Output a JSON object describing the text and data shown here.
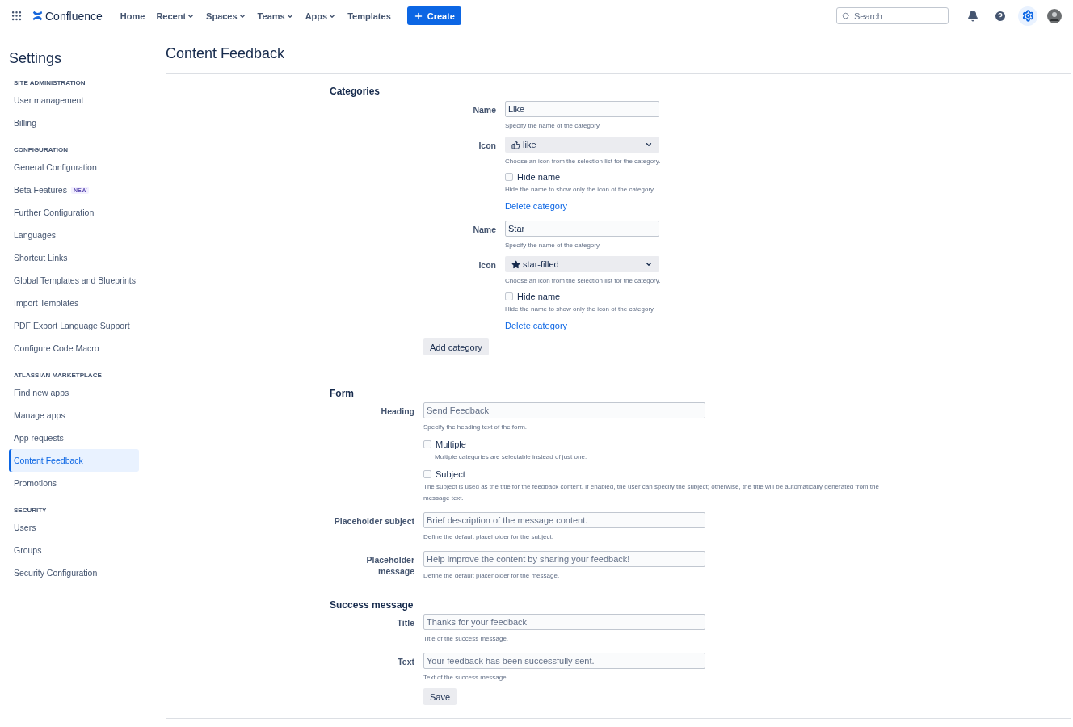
{
  "topbar": {
    "product": "Confluence",
    "nav": [
      {
        "label": "Home",
        "dropdown": false
      },
      {
        "label": "Recent",
        "dropdown": true
      },
      {
        "label": "Spaces",
        "dropdown": true
      },
      {
        "label": "Teams",
        "dropdown": true
      },
      {
        "label": "Apps",
        "dropdown": true
      },
      {
        "label": "Templates",
        "dropdown": false
      }
    ],
    "create": "Create",
    "search": {
      "placeholder": "Search"
    },
    "settings_active": true
  },
  "sidebar": {
    "title": "Settings",
    "sections": [
      {
        "heading": "SITE ADMINISTRATION",
        "items": [
          {
            "label": "User management",
            "selected": false
          },
          {
            "label": "Billing",
            "selected": false
          }
        ]
      },
      {
        "heading": "CONFIGURATION",
        "items": [
          {
            "label": "General Configuration",
            "selected": false
          },
          {
            "label": "Beta Features",
            "badge": "NEW",
            "selected": false
          },
          {
            "label": "Further Configuration",
            "selected": false
          },
          {
            "label": "Languages",
            "selected": false
          },
          {
            "label": "Shortcut Links",
            "selected": false
          },
          {
            "label": "Global Templates and Blueprints",
            "selected": false
          },
          {
            "label": "Import Templates",
            "selected": false
          },
          {
            "label": "PDF Export Language Support",
            "selected": false
          },
          {
            "label": "Configure Code Macro",
            "selected": false
          }
        ]
      },
      {
        "heading": "ATLASSIAN MARKETPLACE",
        "items": [
          {
            "label": "Find new apps",
            "selected": false
          },
          {
            "label": "Manage apps",
            "selected": false
          },
          {
            "label": "App requests",
            "selected": false
          },
          {
            "label": "Content Feedback",
            "selected": true
          },
          {
            "label": "Promotions",
            "selected": false
          }
        ]
      },
      {
        "heading": "SECURITY",
        "items": [
          {
            "label": "Users",
            "selected": false
          },
          {
            "label": "Groups",
            "selected": false
          },
          {
            "label": "Security Configuration",
            "selected": false
          }
        ]
      }
    ]
  },
  "page_title": "Content Feedback",
  "categories": {
    "heading": "Categories",
    "items": [
      {
        "name_label": "Name",
        "name_value": "Like",
        "name_hint": "Specify the name of the category.",
        "icon_label": "Icon",
        "kind": "thumb",
        "icon_value": "like",
        "icon_hint": "Choose an icon from the selection list for the category.",
        "hide_label": "Hide name",
        "hide_checked": false,
        "hide_hint": "Hide the name to show only the icon of the category.",
        "delete": "Delete category"
      },
      {
        "name_label": "Name",
        "name_value": "Star",
        "name_hint": "Specify the name of the category.",
        "icon_label": "Icon",
        "kind": "star",
        "icon_value": "star-filled",
        "icon_hint": "Choose an icon from the selection list for the category.",
        "hide_label": "Hide name",
        "hide_checked": false,
        "hide_hint": "Hide the name to show only the icon of the category.",
        "delete": "Delete category"
      }
    ],
    "add_button": "Add category"
  },
  "form": {
    "heading": "Form",
    "fields": [
      {
        "kind": "text",
        "label": "Heading",
        "placeholder": "Send Feedback",
        "hint": "Specify the heading text of the form."
      },
      {
        "kind": "checkbox",
        "label": "Multiple",
        "checked": false,
        "hint": "Multiple categories are selectable instead of just one."
      },
      {
        "kind": "checkbox",
        "label": "Subject",
        "checked": false,
        "hint": "The subject is used as the title for the feedback content. If enabled, the user can specify the subject; otherwise, the title will be automatically generated from the message text."
      },
      {
        "kind": "text",
        "label": "Placeholder subject",
        "placeholder": "Brief description of the message content.",
        "hint": "Define the default placeholder for the subject."
      },
      {
        "kind": "text",
        "label": "Placeholder message",
        "placeholder": "Help improve the content by sharing your feedback!",
        "hint": "Define the default placeholder for the message."
      }
    ]
  },
  "success": {
    "heading": "Success message",
    "fields": [
      {
        "kind": "text",
        "label": "Title",
        "placeholder": "Thanks for your feedback",
        "hint": "Title of the success message."
      },
      {
        "kind": "text",
        "label": "Text",
        "placeholder": "Your feedback has been successfully sent.",
        "hint": "Text of the success message."
      }
    ],
    "save": "Save"
  }
}
